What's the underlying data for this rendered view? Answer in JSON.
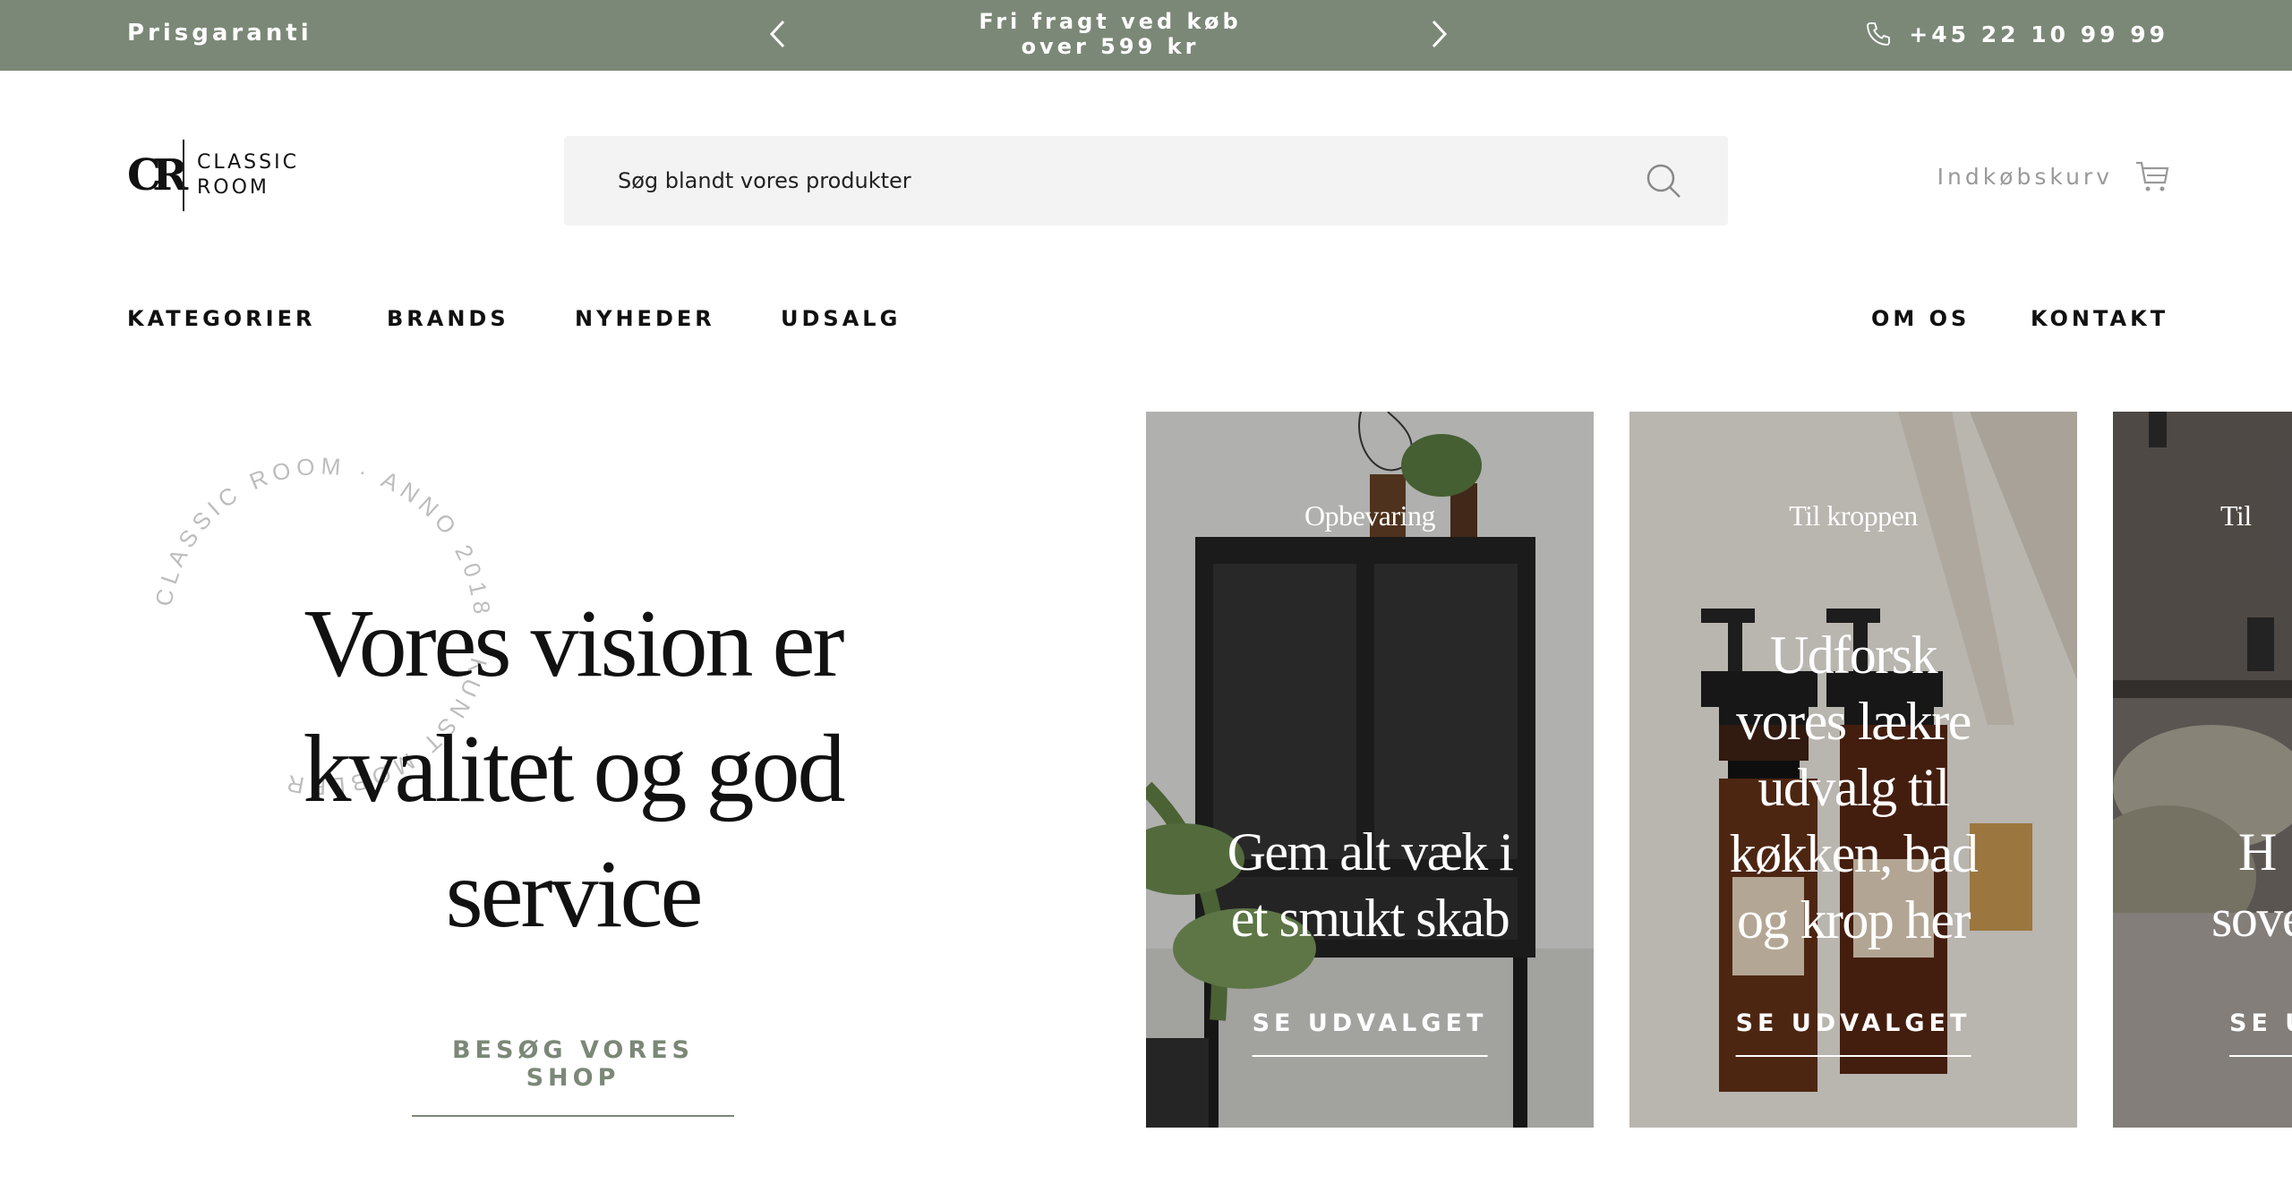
{
  "topbar": {
    "left_text": "Prisgaranti",
    "promo_line1": "Fri fragt ved køb",
    "promo_line2": "over 599 kr",
    "phone": "+45 22 10 99 99"
  },
  "logo": {
    "mark": "CR",
    "line1": "CLASSIC",
    "line2": "ROOM"
  },
  "search": {
    "placeholder": "Søg blandt vores produkter"
  },
  "cart": {
    "label": "Indkøbskurv"
  },
  "nav": {
    "left": [
      "KATEGORIER",
      "BRANDS",
      "NYHEDER",
      "UDSALG"
    ],
    "right": [
      "OM OS",
      "KONTAKT"
    ]
  },
  "hero": {
    "ring_text": "CLASSIC ROOM · ANNO 2018 · KUNST MØBLER",
    "title_line1": "Vores vision er",
    "title_line2": "kvalitet og god",
    "title_line3": "service",
    "cta": "BESØG VORES SHOP"
  },
  "cards": [
    {
      "category": "Opbevaring",
      "headline_line1": "Gem alt væk i",
      "headline_line2": "et smukt skab",
      "cta": "SE UDVALGET"
    },
    {
      "category": "Til kroppen",
      "headline_line1": "Udforsk",
      "headline_line2": "vores lækre",
      "headline_line3": "udvalg til",
      "headline_line4": "køkken, bad",
      "headline_line5": "og krop her",
      "cta": "SE UDVALGET"
    },
    {
      "category": "Til",
      "headline_line1": "H",
      "headline_line2": "sove",
      "cta": "SE U"
    }
  ],
  "colors": {
    "accent": "#7b8877",
    "search_bg": "#f3f3f3",
    "muted_text": "#999999"
  }
}
